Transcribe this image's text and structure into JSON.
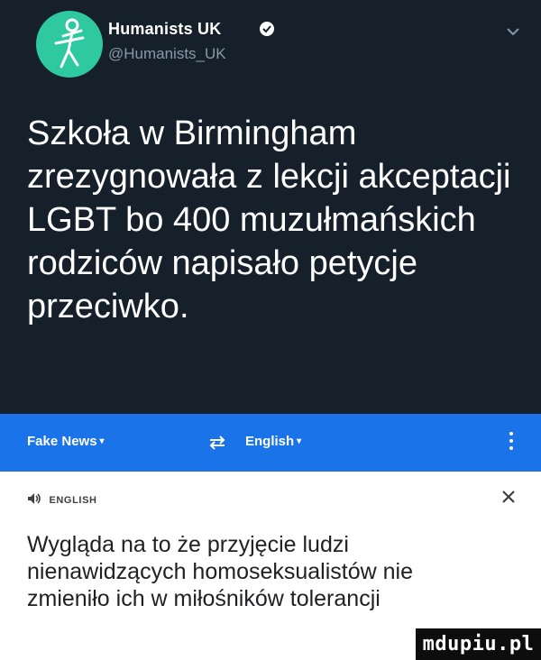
{
  "tweet": {
    "display_name": "Humanists UK",
    "handle": "@Humanists_UK",
    "text": "Szkoła w Birmingham zrezygnowała z lekcji akceptacji LGBT bo 400 muzułmańskich rodziców napisało petycje przeciwko.",
    "avatar_icon": "humanist-logo-icon",
    "verified_icon": "verified-badge-icon",
    "menu_icon": "chevron-down-icon",
    "colors": {
      "background": "#15202b",
      "text": "#ffffff",
      "muted": "#8899a6",
      "avatar": "#2ec9a0"
    }
  },
  "translate": {
    "source_language": "Fake News",
    "target_language": "English",
    "swap_icon": "swap-languages-icon",
    "more_icon": "more-vert-icon",
    "speaker_icon": "speaker-icon",
    "language_label": "ENGLISH",
    "close_icon": "close-icon",
    "translation": "Wygląda na to że przyjęcie ludzi nienawidzących homoseksualistów nie zmieniło ich w miłośników tolerancji",
    "colors": {
      "toolbar": "#1a73e8",
      "background": "#ffffff",
      "text": "#202124"
    }
  },
  "watermark": {
    "text": "mdupiu.pl"
  }
}
